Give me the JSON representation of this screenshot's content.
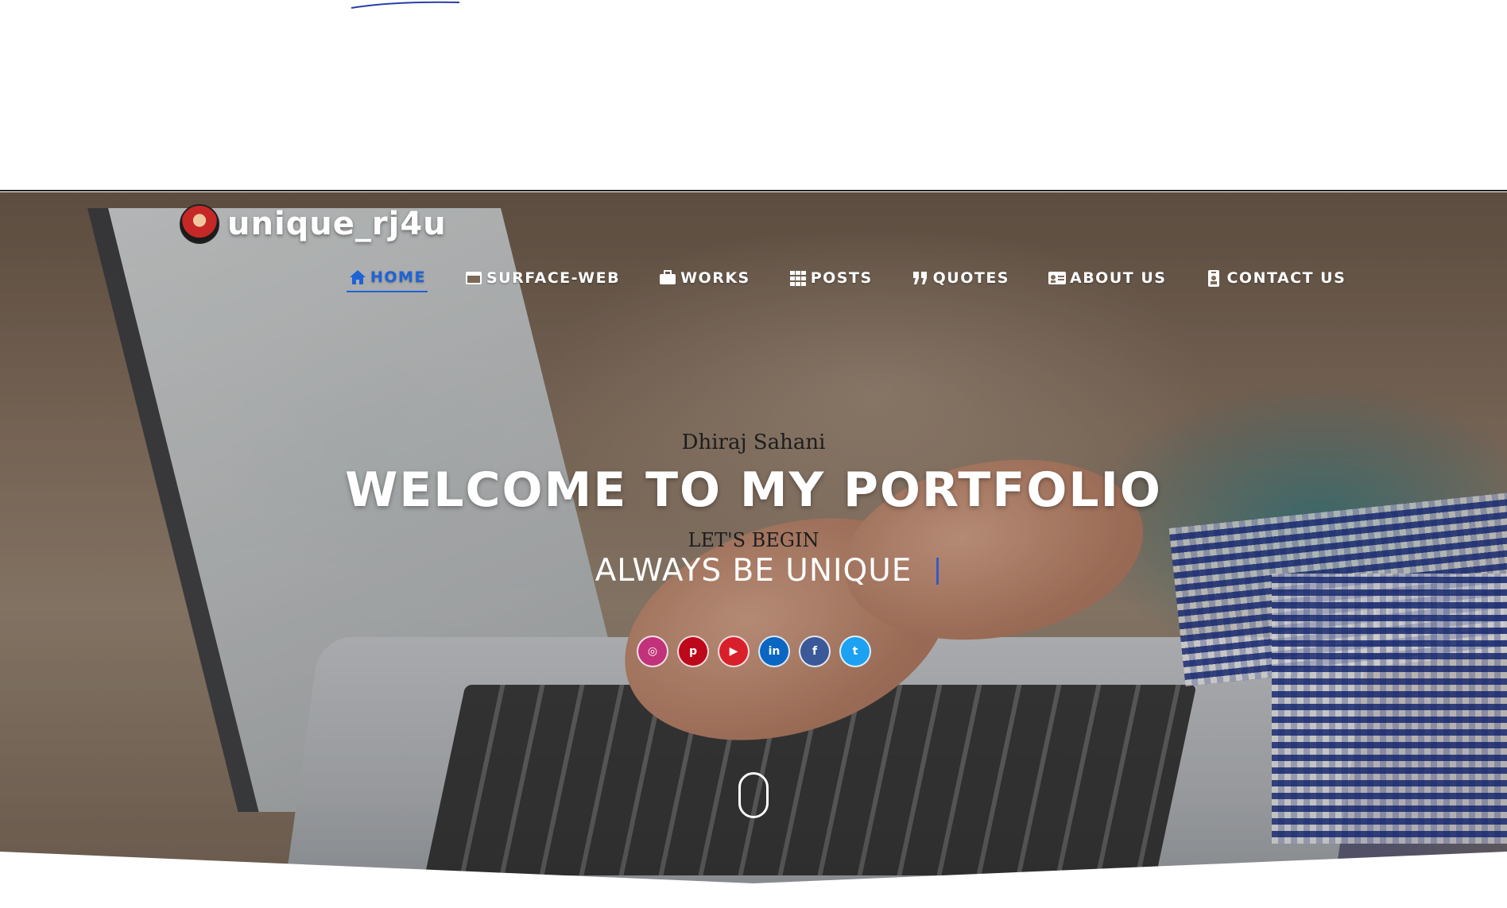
{
  "brand": {
    "name": "unique_rj4u"
  },
  "nav": {
    "items": [
      {
        "label": "HOME",
        "icon": "home-icon",
        "active": true
      },
      {
        "label": "SURFACE-WEB",
        "icon": "window-icon",
        "active": false
      },
      {
        "label": "WORKS",
        "icon": "briefcase-icon",
        "active": false
      },
      {
        "label": "POSTS",
        "icon": "grid-icon",
        "active": false
      },
      {
        "label": "QUOTES",
        "icon": "quote-icon",
        "active": false
      },
      {
        "label": "ABOUT US",
        "icon": "id-card-icon",
        "active": false
      },
      {
        "label": "CONTACT US",
        "icon": "badge-icon",
        "active": false
      }
    ],
    "active_color": "#1e63d6"
  },
  "hero": {
    "kicker": "Dhiraj Sahani",
    "headline": "WELCOME TO MY PORTFOLIO",
    "sub_kicker": "LET'S BEGIN",
    "typed_text": "ALWAYS BE UNIQUE"
  },
  "socials": [
    {
      "name": "instagram-icon",
      "glyph": "◎",
      "color": "#c2327a"
    },
    {
      "name": "pinterest-icon",
      "glyph": "p",
      "color": "#bd081c"
    },
    {
      "name": "youtube-icon",
      "glyph": "▶",
      "color": "#d8202a"
    },
    {
      "name": "linkedin-icon",
      "glyph": "in",
      "color": "#0a66c2"
    },
    {
      "name": "facebook-icon",
      "glyph": "f",
      "color": "#3b5998"
    },
    {
      "name": "twitter-icon",
      "glyph": "t",
      "color": "#1da1f2"
    }
  ]
}
